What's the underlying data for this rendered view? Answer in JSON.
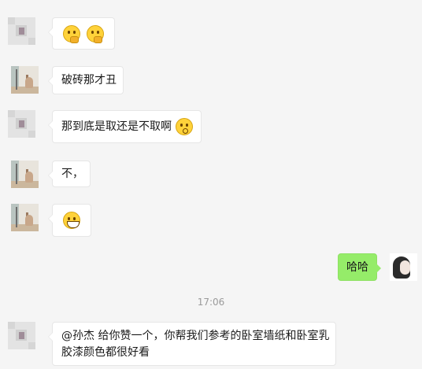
{
  "chat": {
    "messages": [
      {
        "sender": "other",
        "text": "",
        "emoji": [
          "thinking-face",
          "thinking-face"
        ]
      },
      {
        "sender": "other",
        "text": "破砖那才丑"
      },
      {
        "sender": "other",
        "text": "那到底是取还是不取啊",
        "emoji": [
          "confused-face"
        ]
      },
      {
        "sender": "other",
        "text": "不，"
      },
      {
        "sender": "other",
        "text": "",
        "emoji": [
          "grinning-face"
        ]
      },
      {
        "sender": "self",
        "text": "哈哈"
      }
    ],
    "timestamp": "17:06",
    "last_message": {
      "line1": "@孙杰 给你赞一个，你帮我们参考的卧室墙纸和卧室乳",
      "line2": "胶漆颜色都很好看"
    }
  },
  "colors": {
    "background": "#f5f5f5",
    "bubble_other": "#ffffff",
    "bubble_self": "#95ec69",
    "timestamp_text": "#9a9a9a"
  }
}
